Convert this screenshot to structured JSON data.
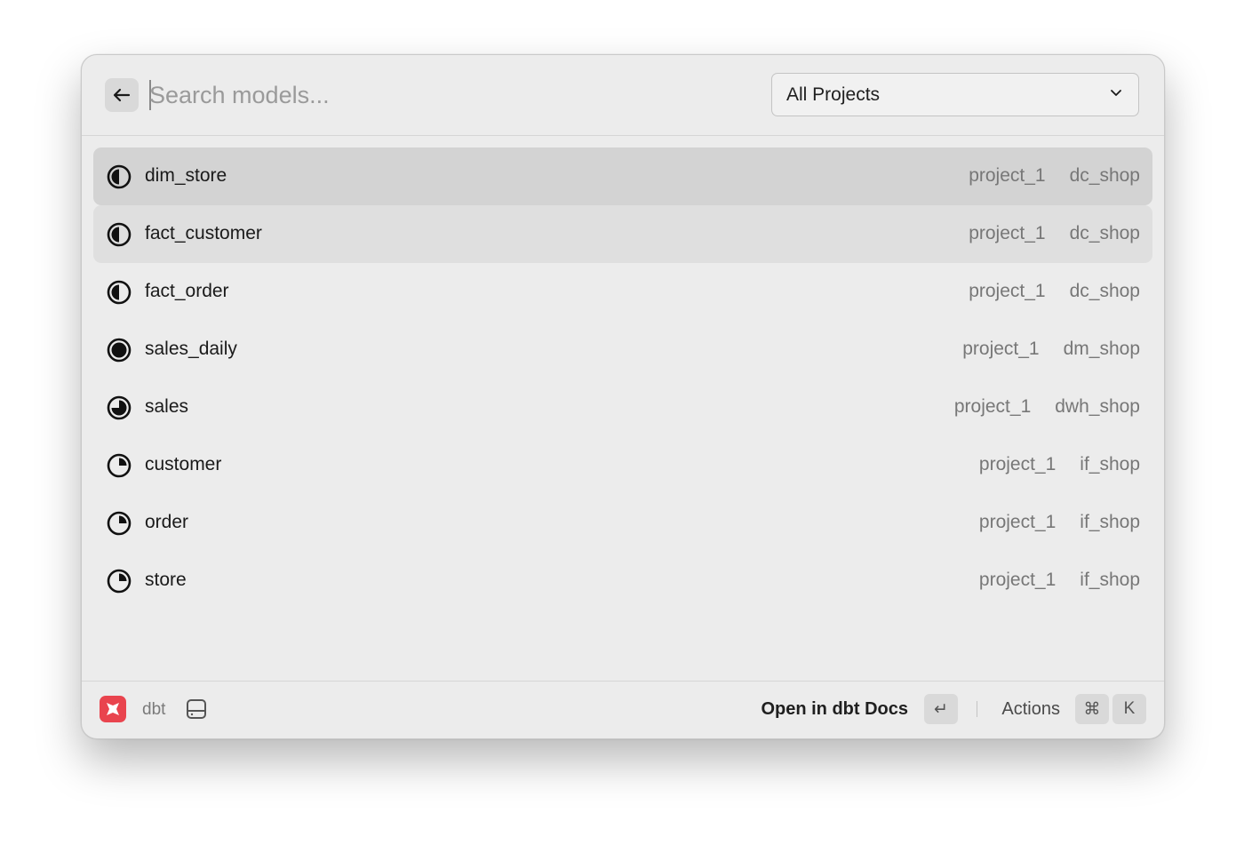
{
  "search": {
    "placeholder": "Search models..."
  },
  "project_filter": {
    "selected": "All Projects"
  },
  "models": [
    {
      "name": "dim_store",
      "project": "project_1",
      "schema": "dc_shop",
      "icon": "half-circle-icon",
      "state": "selected"
    },
    {
      "name": "fact_customer",
      "project": "project_1",
      "schema": "dc_shop",
      "icon": "half-circle-icon",
      "state": "hovered"
    },
    {
      "name": "fact_order",
      "project": "project_1",
      "schema": "dc_shop",
      "icon": "half-circle-icon",
      "state": ""
    },
    {
      "name": "sales_daily",
      "project": "project_1",
      "schema": "dm_shop",
      "icon": "full-circle-icon",
      "state": ""
    },
    {
      "name": "sales",
      "project": "project_1",
      "schema": "dwh_shop",
      "icon": "three-quarter-circle-icon",
      "state": ""
    },
    {
      "name": "customer",
      "project": "project_1",
      "schema": "if_shop",
      "icon": "quarter-circle-icon",
      "state": ""
    },
    {
      "name": "order",
      "project": "project_1",
      "schema": "if_shop",
      "icon": "quarter-circle-icon",
      "state": ""
    },
    {
      "name": "store",
      "project": "project_1",
      "schema": "if_shop",
      "icon": "quarter-circle-icon",
      "state": ""
    }
  ],
  "footer": {
    "app_name": "dbt",
    "primary_action": "Open in dbt Docs",
    "enter_key": "↵",
    "actions_label": "Actions",
    "cmd_key": "⌘",
    "k_key": "K"
  },
  "colors": {
    "window_bg": "#ececec",
    "selected_row": "#d3d3d3",
    "hovered_row": "#dfdfdf",
    "app_logo": "#e9444e"
  }
}
